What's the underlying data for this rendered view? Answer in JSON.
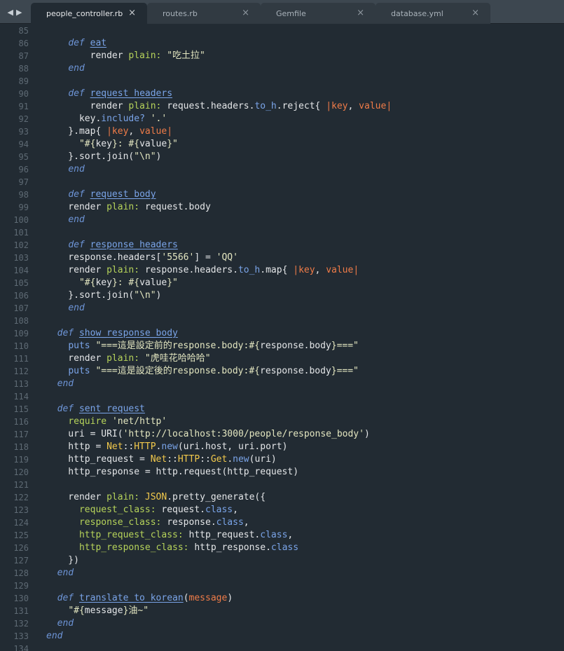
{
  "nav": {
    "back_icon": "◀",
    "forward_icon": "▶"
  },
  "tabs": [
    {
      "label": "people_controller.rb",
      "close": "×",
      "active": true
    },
    {
      "label": "routes.rb",
      "close": "×",
      "active": false
    },
    {
      "label": "Gemfile",
      "close": "×",
      "active": false
    },
    {
      "label": "database.yml",
      "close": "×",
      "active": false
    }
  ],
  "colors": {
    "background": "#222b33",
    "keyword": "#6d94d6",
    "symbol": "#b6d35a",
    "string": "#e3e6c0",
    "constant": "#f2c94c",
    "block_variable": "#f07c48"
  },
  "lines": [
    {
      "n": "85",
      "tokens": []
    },
    {
      "n": "86",
      "tokens": [
        [
          "    ",
          ""
        ],
        [
          "def",
          "kw"
        ],
        [
          " ",
          ""
        ],
        [
          "eat",
          "fn"
        ]
      ]
    },
    {
      "n": "87",
      "tokens": [
        [
          "        render ",
          ""
        ],
        [
          "plain:",
          "sym"
        ],
        [
          " ",
          ""
        ],
        [
          "\"吃土拉\"",
          "str"
        ]
      ]
    },
    {
      "n": "88",
      "tokens": [
        [
          "    ",
          ""
        ],
        [
          "end",
          "kw"
        ]
      ]
    },
    {
      "n": "89",
      "tokens": []
    },
    {
      "n": "90",
      "tokens": [
        [
          "    ",
          ""
        ],
        [
          "def",
          "kw"
        ],
        [
          " ",
          ""
        ],
        [
          "request_headers",
          "fn"
        ]
      ]
    },
    {
      "n": "91",
      "tokens": [
        [
          "        render ",
          ""
        ],
        [
          "plain:",
          "sym"
        ],
        [
          " request.headers.",
          ""
        ],
        [
          "to_h",
          "meth"
        ],
        [
          ".reject{ ",
          ""
        ],
        [
          "|",
          "pipe"
        ],
        [
          "key",
          "var"
        ],
        [
          ", ",
          ""
        ],
        [
          "value",
          "var"
        ],
        [
          "|",
          "pipe"
        ]
      ]
    },
    {
      "n": "92",
      "tokens": [
        [
          "      key.",
          ""
        ],
        [
          "include?",
          "meth"
        ],
        [
          " ",
          ""
        ],
        [
          "'.'",
          "str"
        ]
      ]
    },
    {
      "n": "93",
      "tokens": [
        [
          "    }.map{ ",
          ""
        ],
        [
          "|",
          "pipe"
        ],
        [
          "key",
          "var"
        ],
        [
          ", ",
          ""
        ],
        [
          "value",
          "var"
        ],
        [
          "|",
          "pipe"
        ]
      ]
    },
    {
      "n": "94",
      "tokens": [
        [
          "      ",
          ""
        ],
        [
          "\"#{",
          "str"
        ],
        [
          "key",
          "punc"
        ],
        [
          "}: #{",
          "str"
        ],
        [
          "value",
          "punc"
        ],
        [
          "}\"",
          "str"
        ]
      ]
    },
    {
      "n": "95",
      "tokens": [
        [
          "    }.sort.join(",
          ""
        ],
        [
          "\"\\n\"",
          "str"
        ],
        [
          ")",
          ""
        ]
      ]
    },
    {
      "n": "96",
      "tokens": [
        [
          "    ",
          ""
        ],
        [
          "end",
          "kw"
        ]
      ]
    },
    {
      "n": "97",
      "tokens": []
    },
    {
      "n": "98",
      "tokens": [
        [
          "    ",
          ""
        ],
        [
          "def",
          "kw"
        ],
        [
          " ",
          ""
        ],
        [
          "request_body",
          "fn"
        ]
      ]
    },
    {
      "n": "99",
      "tokens": [
        [
          "    render ",
          ""
        ],
        [
          "plain:",
          "sym"
        ],
        [
          " request.body",
          ""
        ]
      ]
    },
    {
      "n": "100",
      "tokens": [
        [
          "    ",
          ""
        ],
        [
          "end",
          "kw"
        ]
      ]
    },
    {
      "n": "101",
      "tokens": []
    },
    {
      "n": "102",
      "tokens": [
        [
          "    ",
          ""
        ],
        [
          "def",
          "kw"
        ],
        [
          " ",
          ""
        ],
        [
          "response_headers",
          "fn"
        ]
      ]
    },
    {
      "n": "103",
      "tokens": [
        [
          "    response.headers[",
          ""
        ],
        [
          "'5566'",
          "str"
        ],
        [
          "] = ",
          ""
        ],
        [
          "'QQ'",
          "str"
        ]
      ]
    },
    {
      "n": "104",
      "tokens": [
        [
          "    render ",
          ""
        ],
        [
          "plain:",
          "sym"
        ],
        [
          " response.headers.",
          ""
        ],
        [
          "to_h",
          "meth"
        ],
        [
          ".map{ ",
          ""
        ],
        [
          "|",
          "pipe"
        ],
        [
          "key",
          "var"
        ],
        [
          ", ",
          ""
        ],
        [
          "value",
          "var"
        ],
        [
          "|",
          "pipe"
        ]
      ]
    },
    {
      "n": "105",
      "tokens": [
        [
          "      ",
          ""
        ],
        [
          "\"#{",
          "str"
        ],
        [
          "key",
          "punc"
        ],
        [
          "}: #{",
          "str"
        ],
        [
          "value",
          "punc"
        ],
        [
          "}\"",
          "str"
        ]
      ]
    },
    {
      "n": "106",
      "tokens": [
        [
          "    }.sort.join(",
          ""
        ],
        [
          "\"\\n\"",
          "str"
        ],
        [
          ")",
          ""
        ]
      ]
    },
    {
      "n": "107",
      "tokens": [
        [
          "    ",
          ""
        ],
        [
          "end",
          "kw"
        ]
      ]
    },
    {
      "n": "108",
      "tokens": []
    },
    {
      "n": "109",
      "tokens": [
        [
          "  ",
          ""
        ],
        [
          "def",
          "kw"
        ],
        [
          " ",
          ""
        ],
        [
          "show_response_body",
          "fn"
        ]
      ]
    },
    {
      "n": "110",
      "tokens": [
        [
          "    ",
          ""
        ],
        [
          "puts",
          "meth"
        ],
        [
          " ",
          ""
        ],
        [
          "\"===這是設定前的response.body:#{",
          "str"
        ],
        [
          "response.body",
          "punc"
        ],
        [
          "}===\"",
          "str"
        ]
      ]
    },
    {
      "n": "111",
      "tokens": [
        [
          "    render ",
          ""
        ],
        [
          "plain:",
          "sym"
        ],
        [
          " ",
          ""
        ],
        [
          "\"虎哇花哈哈哈\"",
          "str"
        ]
      ]
    },
    {
      "n": "112",
      "tokens": [
        [
          "    ",
          ""
        ],
        [
          "puts",
          "meth"
        ],
        [
          " ",
          ""
        ],
        [
          "\"===這是設定後的response.body:#{",
          "str"
        ],
        [
          "response.body",
          "punc"
        ],
        [
          "}===\"",
          "str"
        ]
      ]
    },
    {
      "n": "113",
      "tokens": [
        [
          "  ",
          ""
        ],
        [
          "end",
          "kw"
        ]
      ]
    },
    {
      "n": "114",
      "tokens": []
    },
    {
      "n": "115",
      "tokens": [
        [
          "  ",
          ""
        ],
        [
          "def",
          "kw"
        ],
        [
          " ",
          ""
        ],
        [
          "sent_request",
          "fn"
        ]
      ]
    },
    {
      "n": "116",
      "tokens": [
        [
          "    ",
          ""
        ],
        [
          "require",
          "sym"
        ],
        [
          " ",
          ""
        ],
        [
          "'net/http'",
          "str"
        ]
      ]
    },
    {
      "n": "117",
      "tokens": [
        [
          "    uri = URI(",
          ""
        ],
        [
          "'http://localhost:3000/people/response_body'",
          "str"
        ],
        [
          ")",
          ""
        ]
      ]
    },
    {
      "n": "118",
      "tokens": [
        [
          "    http = ",
          ""
        ],
        [
          "Net",
          "const"
        ],
        [
          "::",
          ""
        ],
        [
          "HTTP",
          "const"
        ],
        [
          ".",
          ""
        ],
        [
          "new",
          "meth"
        ],
        [
          "(uri.host, uri.port)",
          ""
        ]
      ]
    },
    {
      "n": "119",
      "tokens": [
        [
          "    http_request = ",
          ""
        ],
        [
          "Net",
          "const"
        ],
        [
          "::",
          ""
        ],
        [
          "HTTP",
          "const"
        ],
        [
          "::",
          ""
        ],
        [
          "Get",
          "const"
        ],
        [
          ".",
          ""
        ],
        [
          "new",
          "meth"
        ],
        [
          "(uri)",
          ""
        ]
      ]
    },
    {
      "n": "120",
      "tokens": [
        [
          "    http_response = http.request(http_request)",
          ""
        ]
      ]
    },
    {
      "n": "121",
      "tokens": []
    },
    {
      "n": "122",
      "tokens": [
        [
          "    render ",
          ""
        ],
        [
          "plain:",
          "sym"
        ],
        [
          " ",
          ""
        ],
        [
          "JSON",
          "const"
        ],
        [
          ".pretty_generate({",
          ""
        ]
      ]
    },
    {
      "n": "123",
      "tokens": [
        [
          "      ",
          ""
        ],
        [
          "request_class:",
          "sym"
        ],
        [
          " request.",
          ""
        ],
        [
          "class",
          "meth"
        ],
        [
          ",",
          ""
        ]
      ]
    },
    {
      "n": "124",
      "tokens": [
        [
          "      ",
          ""
        ],
        [
          "response_class:",
          "sym"
        ],
        [
          " response.",
          ""
        ],
        [
          "class",
          "meth"
        ],
        [
          ",",
          ""
        ]
      ]
    },
    {
      "n": "125",
      "tokens": [
        [
          "      ",
          ""
        ],
        [
          "http_request_class:",
          "sym"
        ],
        [
          " http_request.",
          ""
        ],
        [
          "class",
          "meth"
        ],
        [
          ",",
          ""
        ]
      ]
    },
    {
      "n": "126",
      "tokens": [
        [
          "      ",
          ""
        ],
        [
          "http_response_class:",
          "sym"
        ],
        [
          " http_response.",
          ""
        ],
        [
          "class",
          "meth"
        ]
      ]
    },
    {
      "n": "127",
      "tokens": [
        [
          "    })",
          ""
        ]
      ]
    },
    {
      "n": "128",
      "tokens": [
        [
          "  ",
          ""
        ],
        [
          "end",
          "kw"
        ]
      ]
    },
    {
      "n": "129",
      "tokens": []
    },
    {
      "n": "130",
      "tokens": [
        [
          "  ",
          ""
        ],
        [
          "def",
          "kw"
        ],
        [
          " ",
          ""
        ],
        [
          "translate_to_korean",
          "fn"
        ],
        [
          "(",
          ""
        ],
        [
          "message",
          "var"
        ],
        [
          ")",
          ""
        ]
      ]
    },
    {
      "n": "131",
      "tokens": [
        [
          "    ",
          ""
        ],
        [
          "\"#{",
          "str"
        ],
        [
          "message",
          "punc"
        ],
        [
          "}油~\"",
          "str"
        ]
      ]
    },
    {
      "n": "132",
      "tokens": [
        [
          "  ",
          ""
        ],
        [
          "end",
          "kw"
        ]
      ]
    },
    {
      "n": "133",
      "tokens": [
        [
          "",
          ""
        ],
        [
          "end",
          "kw"
        ]
      ]
    },
    {
      "n": "134",
      "tokens": []
    }
  ]
}
